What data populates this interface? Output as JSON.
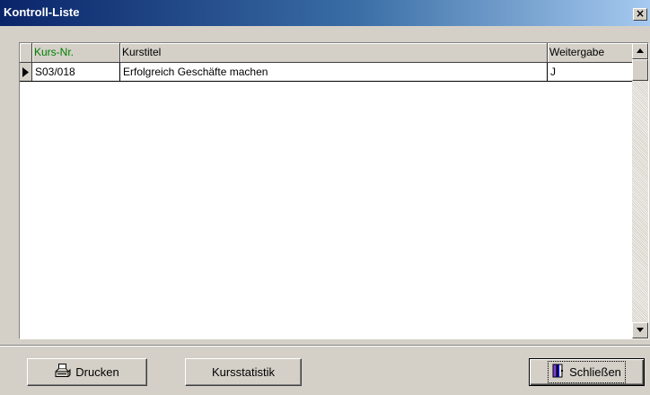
{
  "window": {
    "title": "Kontroll-Liste",
    "close_label": "×"
  },
  "grid": {
    "columns": [
      "Kurs-Nr.",
      "Kurstitel",
      "Weitergabe"
    ],
    "rows": [
      [
        "S03/018",
        "Erfolgreich Geschäfte machen",
        "J"
      ]
    ],
    "key_column_color": "#008000"
  },
  "buttons": {
    "print_label": "Drucken",
    "stats_label": "Kursstatistik",
    "close_label": "Schließen"
  },
  "icons": {
    "print": "printer-icon",
    "close": "door-icon",
    "row_pointer": "row-pointer-icon"
  },
  "colors": {
    "title_start": "#0a246a",
    "title_end": "#a6caf0",
    "face": "#d4d0c8"
  }
}
